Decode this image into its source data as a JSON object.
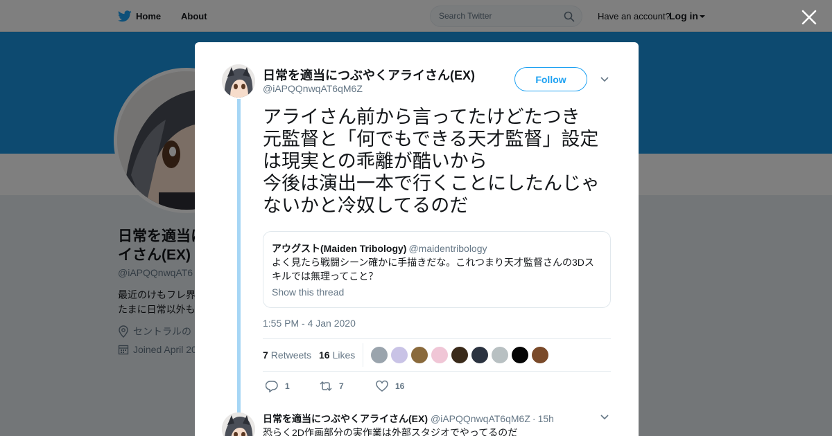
{
  "topbar": {
    "home_label": "Home",
    "about_label": "About",
    "search_placeholder": "Search Twitter",
    "have_account": "Have an account?",
    "login_label": "Log in"
  },
  "profile_bg": {
    "name_line1": "日常を適当に",
    "name_line2": "イさん(EX)",
    "handle": "@iAPQQnwqAT6",
    "bio_line1": "最近のけもフレ界",
    "bio_line2": "たまに日常以外も",
    "location": "セントラルの",
    "joined": "Joined April 20"
  },
  "modal": {
    "author_name": "日常を適当につぶやくアライさん(EX)",
    "author_handle": "@iAPQQnwqAT6qM6Z",
    "follow_label": "Follow",
    "tweet_text": "アライさん前から言ってたけどたつき\n元監督と「何でもできる天才監督」設定\nは現実との乖離が酷いから\n今後は演出一本で行くことにしたんじゃ\nないかと冷奴してるのだ",
    "quote": {
      "name": "アウグスト(Maiden Tribology)",
      "handle": "@maidentribology",
      "text": "よく見たら戦闘シーン確かに手描きだな。これつまり天才監督さんの3Dスキルでは無理ってこと？",
      "show_thread": "Show this thread"
    },
    "timestamp": "1:55 PM - 4 Jan 2020",
    "retweets_count": "7",
    "retweets_label": "Retweets",
    "likes_count": "16",
    "likes_label": "Likes",
    "actions": {
      "reply_count": "1",
      "retweet_count": "7",
      "like_count": "16"
    },
    "reply": {
      "name": "日常を適当につぶやくアライさん(EX)",
      "handle": "@iAPQQnwqAT6qM6Z",
      "dot": "·",
      "time": "15h",
      "text": "恐らく2D作画部分の実作業は外部スタジオでやってるのだ"
    }
  },
  "colors": {
    "brand": "#1da1f2",
    "banner": "#1b95e0",
    "thread_line": "#a6d6f5",
    "muted_text": "#657786"
  },
  "facepile_colors": [
    "#9aa4ad",
    "#c9c3e6",
    "#8a6a3c",
    "#f0c6d6",
    "#3a2a1a",
    "#2b3340",
    "#b8c0c2",
    "#050505",
    "#7a4a2a"
  ],
  "icons": [
    "twitter-bird-icon",
    "search-icon",
    "close-icon",
    "chevron-down-icon",
    "location-icon",
    "calendar-icon",
    "reply-icon",
    "retweet-icon",
    "heart-icon"
  ]
}
